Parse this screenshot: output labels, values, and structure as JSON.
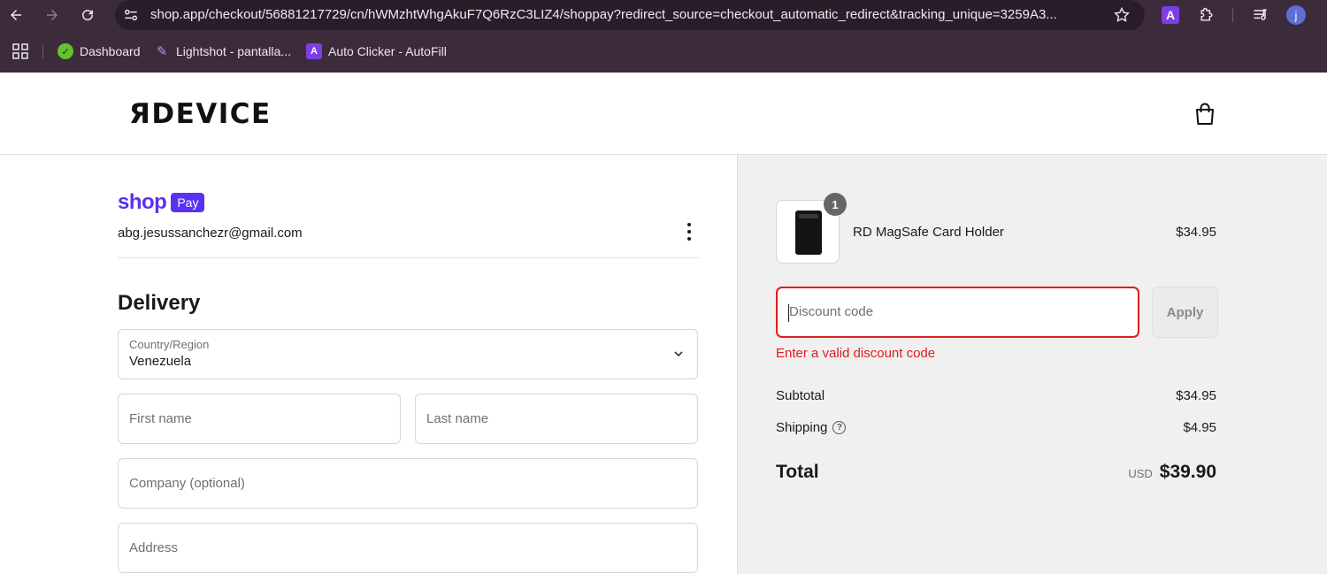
{
  "browser": {
    "url": "shop.app/checkout/56881217729/cn/hWMzhtWhgAkuF7Q6RzC3LIZ4/shoppay?redirect_source=checkout_automatic_redirect&tracking_unique=3259A3...",
    "profile_initial": "j",
    "bookmarks": [
      {
        "label": "Dashboard",
        "icon": "dashboard-icon"
      },
      {
        "label": "Lightshot - pantalla...",
        "icon": "feather-icon"
      },
      {
        "label": "Auto Clicker - AutoFill",
        "icon": "auto-clicker-icon"
      }
    ]
  },
  "store": {
    "logo": "ЯDEVICE",
    "cart_icon": "shopping-bag-icon"
  },
  "account": {
    "brand_shop": "shop",
    "brand_pay": "Pay",
    "email": "abg.jesussanchezr@gmail.com"
  },
  "delivery": {
    "title": "Delivery",
    "country_label": "Country/Region",
    "country_value": "Venezuela",
    "first_name_placeholder": "First name",
    "last_name_placeholder": "Last name",
    "company_placeholder": "Company (optional)",
    "address_placeholder": "Address"
  },
  "summary": {
    "item_quantity": "1",
    "item_name": "RD MagSafe Card Holder",
    "item_price": "$34.95",
    "discount_placeholder": "Discount code",
    "apply_label": "Apply",
    "error": "Enter a valid discount code",
    "subtotal_label": "Subtotal",
    "subtotal_value": "$34.95",
    "shipping_label": "Shipping",
    "shipping_value": "$4.95",
    "total_label": "Total",
    "currency": "USD",
    "total_value": "$39.90"
  },
  "colors": {
    "chrome_bg": "#3c2b3b",
    "shop_purple": "#5a31f4",
    "error_red": "#dd1d1d",
    "summary_bg": "#f0f0f0"
  }
}
